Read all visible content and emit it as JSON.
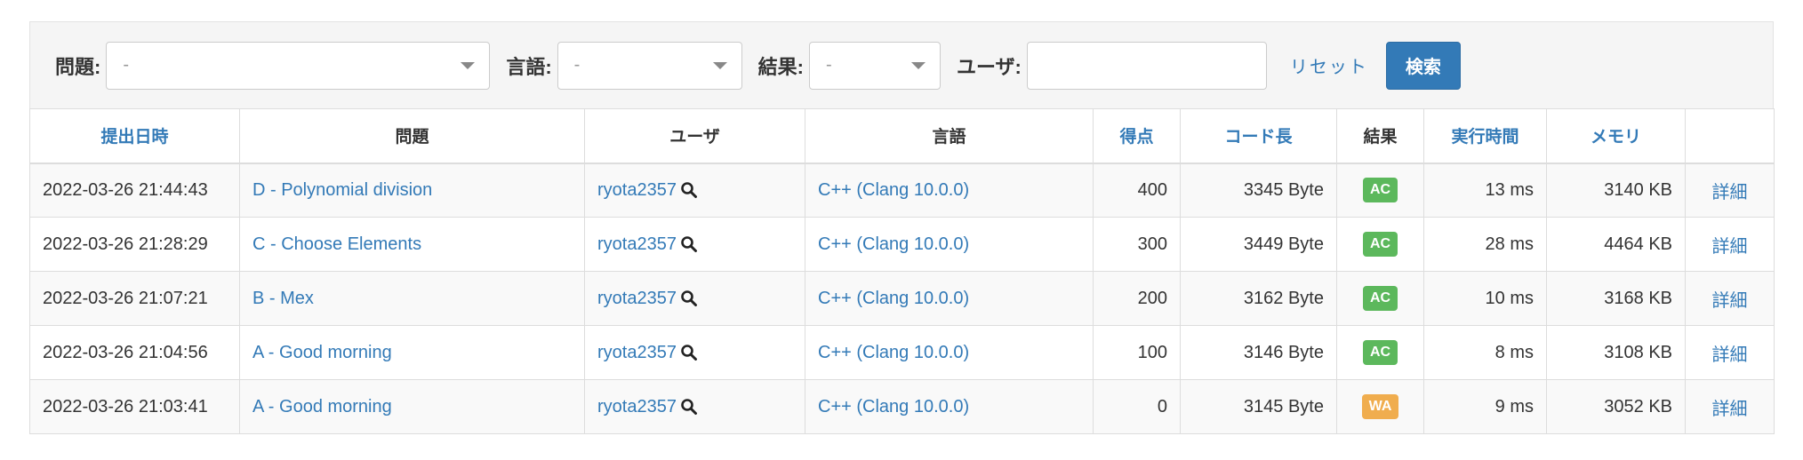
{
  "filters": {
    "problem_label": "問題:",
    "problem_value": "-",
    "language_label": "言語:",
    "language_value": "-",
    "result_label": "結果:",
    "result_value": "-",
    "user_label": "ユーザ:",
    "user_value": "",
    "reset_label": "リセット",
    "search_label": "検索"
  },
  "table": {
    "headers": {
      "submitted_at": "提出日時",
      "problem": "問題",
      "user": "ユーザ",
      "language": "言語",
      "score": "得点",
      "code_length": "コード長",
      "result": "結果",
      "exec_time": "実行時間",
      "memory": "メモリ"
    },
    "rows": [
      {
        "time": "2022-03-26 21:44:43",
        "problem": "D - Polynomial division",
        "user": "ryota2357",
        "lang": "C++ (Clang 10.0.0)",
        "score": "400",
        "code_len": "3345 Byte",
        "status": "AC",
        "exec": "13 ms",
        "mem": "3140 KB",
        "detail": "詳細"
      },
      {
        "time": "2022-03-26 21:28:29",
        "problem": "C - Choose Elements",
        "user": "ryota2357",
        "lang": "C++ (Clang 10.0.0)",
        "score": "300",
        "code_len": "3449 Byte",
        "status": "AC",
        "exec": "28 ms",
        "mem": "4464 KB",
        "detail": "詳細"
      },
      {
        "time": "2022-03-26 21:07:21",
        "problem": "B - Mex",
        "user": "ryota2357",
        "lang": "C++ (Clang 10.0.0)",
        "score": "200",
        "code_len": "3162 Byte",
        "status": "AC",
        "exec": "10 ms",
        "mem": "3168 KB",
        "detail": "詳細"
      },
      {
        "time": "2022-03-26 21:04:56",
        "problem": "A - Good morning",
        "user": "ryota2357",
        "lang": "C++ (Clang 10.0.0)",
        "score": "100",
        "code_len": "3146 Byte",
        "status": "AC",
        "exec": "8 ms",
        "mem": "3108 KB",
        "detail": "詳細"
      },
      {
        "time": "2022-03-26 21:03:41",
        "problem": "A - Good morning",
        "user": "ryota2357",
        "lang": "C++ (Clang 10.0.0)",
        "score": "0",
        "code_len": "3145 Byte",
        "status": "WA",
        "exec": "9 ms",
        "mem": "3052 KB",
        "detail": "詳細"
      }
    ]
  },
  "colors": {
    "link": "#337ab7",
    "ac": "#5cb85c",
    "wa": "#f0ad4e",
    "primary_button": "#337ab7"
  }
}
